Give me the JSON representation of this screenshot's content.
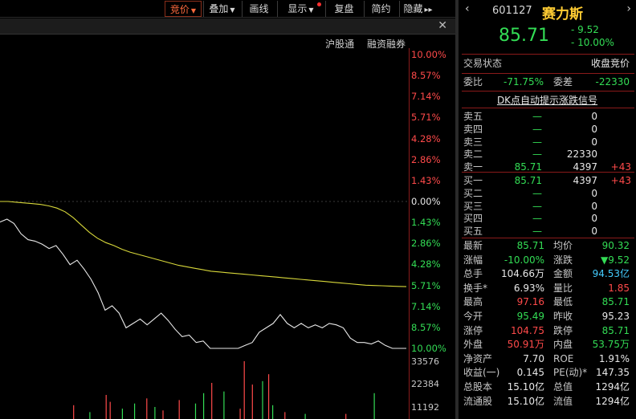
{
  "toolbar": {
    "items": [
      {
        "label": "竞价",
        "active": true,
        "has_arrow": true
      },
      {
        "label": "叠加",
        "has_arrow": true
      },
      {
        "label": "画线"
      },
      {
        "label": "显示",
        "has_arrow": true,
        "has_dot": true
      },
      {
        "label": "复盘"
      },
      {
        "label": "简约"
      },
      {
        "label": "隐藏",
        "has_more": true
      }
    ],
    "more_symbol": "▸▸"
  },
  "header_links": [
    "沪股通",
    "融资融券"
  ],
  "close_symbol": "✕",
  "pct_axis": [
    "10.00%",
    "8.57%",
    "7.14%",
    "5.71%",
    "4.28%",
    "2.86%",
    "1.43%",
    "0.00%",
    "1.43%",
    "2.86%",
    "4.28%",
    "5.71%",
    "7.14%",
    "8.57%",
    "10.00%"
  ],
  "vol_axis": [
    "33576",
    "22384",
    "11192"
  ],
  "colors": {
    "up": "#ff4a4a",
    "down": "#33dd55",
    "flat": "#e8e8e8",
    "avg_line": "#d8d83a",
    "price_line": "#e8e8e8",
    "accent": "#ffcc33"
  },
  "chart_data": {
    "type": "line",
    "ylim_pct": [
      -10,
      10
    ],
    "series": [
      {
        "values_pct": [
          -1.4,
          -1.2,
          -1.5,
          -2.2,
          -2.6,
          -2.7,
          -2.9,
          -3.2,
          -3.0,
          -3.6,
          -4.3,
          -4.0,
          -4.6,
          -5.3,
          -6.2,
          -7.4,
          -7.1,
          -7.6,
          -8.6,
          -8.3,
          -8.0,
          -8.4,
          -8.0,
          -7.6,
          -8.1,
          -8.7,
          -9.2,
          -9.1,
          -9.6,
          -9.5,
          -10,
          -10,
          -10,
          -10,
          -10,
          -9.8,
          -9.6,
          -8.9,
          -8.6,
          -8.3,
          -7.7,
          -8.3,
          -8.6,
          -8.3,
          -8.6,
          -8.4,
          -8.6,
          -8.3,
          -8.4,
          -8.6,
          -9.3,
          -9.6,
          -9.6,
          -9.7,
          -9.5,
          -9.8,
          -10,
          -10,
          -10
        ]
      },
      {
        "values_pct": [
          0,
          0,
          -0.05,
          -0.1,
          -0.15,
          -0.2,
          -0.3,
          -0.45,
          -0.7,
          -1.1,
          -1.6,
          -2.1,
          -2.5,
          -2.8,
          -3.0,
          -3.25,
          -3.45,
          -3.6,
          -3.75,
          -3.9,
          -4.05,
          -4.2,
          -4.35,
          -4.45,
          -4.55,
          -4.65,
          -4.75,
          -4.8,
          -4.85,
          -4.9,
          -4.95,
          -5.0,
          -5.05,
          -5.1,
          -5.15,
          -5.2,
          -5.25,
          -5.3,
          -5.35,
          -5.4,
          -5.45,
          -5.5,
          -5.55,
          -5.6,
          -5.65,
          -5.7,
          -5.72,
          -5.74,
          -5.76,
          -5.78,
          -5.8
        ]
      }
    ],
    "volume": {
      "ylim": [
        0,
        33576
      ],
      "bars": [
        {
          "x": 0.18,
          "v": 8000,
          "c": "up"
        },
        {
          "x": 0.22,
          "v": 4000,
          "c": "down"
        },
        {
          "x": 0.26,
          "v": 14000,
          "c": "up"
        },
        {
          "x": 0.27,
          "v": 10000,
          "c": "up"
        },
        {
          "x": 0.3,
          "v": 6000,
          "c": "down"
        },
        {
          "x": 0.33,
          "v": 9000,
          "c": "down"
        },
        {
          "x": 0.36,
          "v": 12000,
          "c": "up"
        },
        {
          "x": 0.38,
          "v": 7000,
          "c": "down"
        },
        {
          "x": 0.4,
          "v": 5000,
          "c": "up"
        },
        {
          "x": 0.44,
          "v": 11000,
          "c": "up"
        },
        {
          "x": 0.48,
          "v": 9000,
          "c": "down"
        },
        {
          "x": 0.5,
          "v": 15000,
          "c": "down"
        },
        {
          "x": 0.52,
          "v": 21000,
          "c": "up"
        },
        {
          "x": 0.55,
          "v": 16000,
          "c": "down"
        },
        {
          "x": 0.59,
          "v": 6000,
          "c": "up"
        },
        {
          "x": 0.6,
          "v": 33576,
          "c": "up"
        },
        {
          "x": 0.62,
          "v": 20000,
          "c": "up"
        },
        {
          "x": 0.645,
          "v": 22000,
          "c": "down"
        },
        {
          "x": 0.66,
          "v": 26000,
          "c": "up"
        },
        {
          "x": 0.67,
          "v": 8000,
          "c": "down"
        },
        {
          "x": 0.7,
          "v": 4000,
          "c": "up"
        },
        {
          "x": 0.75,
          "v": 3000,
          "c": "down"
        },
        {
          "x": 0.85,
          "v": 3000,
          "c": "up"
        },
        {
          "x": 0.92,
          "v": 15000,
          "c": "down"
        }
      ]
    }
  },
  "quote": {
    "nav_left": "‹",
    "nav_right": "›",
    "code": "601127",
    "name": "赛力斯",
    "price": "85.71",
    "change": "- 9.52",
    "change_pct": "- 10.00%",
    "status_label": "交易状态",
    "status_value": "收盘竞价",
    "wb_label": "委比",
    "wb_value": "-71.75%",
    "wc_label": "委差",
    "wc_value": "-22330",
    "dk_link": "DK点自动提示涨跌信号",
    "asks": [
      {
        "label": "卖五",
        "price": "—",
        "vol": "0",
        "chg": ""
      },
      {
        "label": "卖四",
        "price": "—",
        "vol": "0",
        "chg": ""
      },
      {
        "label": "卖三",
        "price": "—",
        "vol": "0",
        "chg": ""
      },
      {
        "label": "卖二",
        "price": "—",
        "vol": "22330",
        "chg": ""
      },
      {
        "label": "卖一",
        "price": "85.71",
        "vol": "4397",
        "chg": "+43"
      }
    ],
    "bids": [
      {
        "label": "买一",
        "price": "85.71",
        "vol": "4397",
        "chg": "+43"
      },
      {
        "label": "买二",
        "price": "—",
        "vol": "0",
        "chg": ""
      },
      {
        "label": "买三",
        "price": "—",
        "vol": "0",
        "chg": ""
      },
      {
        "label": "买四",
        "price": "—",
        "vol": "0",
        "chg": ""
      },
      {
        "label": "买五",
        "price": "—",
        "vol": "0",
        "chg": ""
      }
    ],
    "stats": [
      {
        "l1": "最新",
        "v1": "85.71",
        "c1": "green",
        "l2": "均价",
        "v2": "90.32",
        "c2": "green"
      },
      {
        "l1": "涨幅",
        "v1": "-10.00%",
        "c1": "green",
        "l2": "涨跌",
        "v2": "▼9.52",
        "c2": "green"
      },
      {
        "l1": "总手",
        "v1": "104.66万",
        "c1": "white",
        "l2": "金额",
        "v2": "94.53亿",
        "c2": "cyan"
      },
      {
        "l1": "换手*",
        "v1": "6.93%",
        "c1": "white",
        "l2": "量比",
        "v2": "1.85",
        "c2": "red"
      },
      {
        "l1": "最高",
        "v1": "97.16",
        "c1": "red",
        "l2": "最低",
        "v2": "85.71",
        "c2": "green"
      },
      {
        "l1": "今开",
        "v1": "95.49",
        "c1": "green",
        "l2": "昨收",
        "v2": "95.23",
        "c2": "white"
      },
      {
        "l1": "涨停",
        "v1": "104.75",
        "c1": "red",
        "l2": "跌停",
        "v2": "85.71",
        "c2": "green"
      },
      {
        "l1": "外盘",
        "v1": "50.91万",
        "c1": "red",
        "l2": "内盘",
        "v2": "53.75万",
        "c2": "green"
      },
      {
        "l1": "净资产",
        "v1": "7.70",
        "c1": "white",
        "l2": "ROE",
        "v2": "1.91%",
        "c2": "white"
      },
      {
        "l1": "收益(一)",
        "v1": "0.145",
        "c1": "white",
        "l2": "PE(动)*",
        "v2": "147.35",
        "c2": "white"
      },
      {
        "l1": "总股本",
        "v1": "15.10亿",
        "c1": "white",
        "l2": "总值",
        "v2": "1294亿",
        "c2": "white"
      },
      {
        "l1": "流通股",
        "v1": "15.10亿",
        "c1": "white",
        "l2": "流值",
        "v2": "1294亿",
        "c2": "white"
      }
    ]
  }
}
